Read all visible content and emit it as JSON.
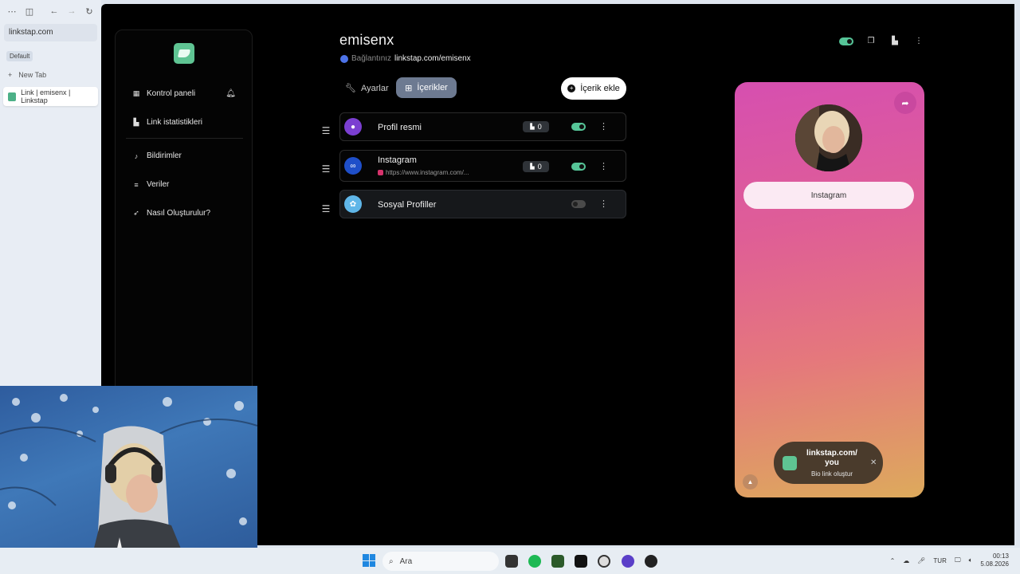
{
  "browser": {
    "url": "linkstap.com",
    "profile": "Default",
    "new_tab": "New Tab",
    "tabs": [
      {
        "title": "Link | emisenx | Linkstap"
      }
    ]
  },
  "nav": {
    "items": [
      {
        "label": "Kontrol paneli",
        "icon": "grid-icon"
      },
      {
        "label": "Link istatistikleri",
        "icon": "chart-icon"
      },
      {
        "label": "Bildirimler",
        "icon": "bell-icon"
      },
      {
        "label": "Veriler",
        "icon": "database-icon"
      },
      {
        "label": "Nasıl Oluşturulur?",
        "icon": "rocket-icon"
      }
    ]
  },
  "header": {
    "username": "emisenx",
    "connection_prefix": "Bağlantınız",
    "connection_link": "linkstap.com/emisenx"
  },
  "tabs": {
    "settings": "Ayarlar",
    "contents": "İçerikler",
    "add_content": "İçerik ekle"
  },
  "items": [
    {
      "title": "Profil resmi",
      "subtitle": "",
      "count": "0",
      "enabled": true,
      "icon_color": "#7b3fd1"
    },
    {
      "title": "Instagram",
      "subtitle": "https://www.instagram.com/...",
      "count": "0",
      "enabled": true,
      "icon_color": "#1f4fc9"
    },
    {
      "title": "Sosyal Profiller",
      "subtitle": "",
      "count": "",
      "enabled": false,
      "icon_color": "#5fb6e8"
    }
  ],
  "preview": {
    "button_label": "Instagram",
    "promo_link": "linkstap.com/ you",
    "promo_cta": "Bio link oluştur"
  },
  "taskbar": {
    "search_placeholder": "Ara",
    "language": "TUR",
    "time": "00:13",
    "date": "5.08.2026"
  },
  "colors": {
    "accent_green": "#56c598",
    "active_tab": "#6d7a91",
    "phone_gradient_top": "#d64fb0",
    "phone_gradient_bottom": "#ddaa5c"
  }
}
